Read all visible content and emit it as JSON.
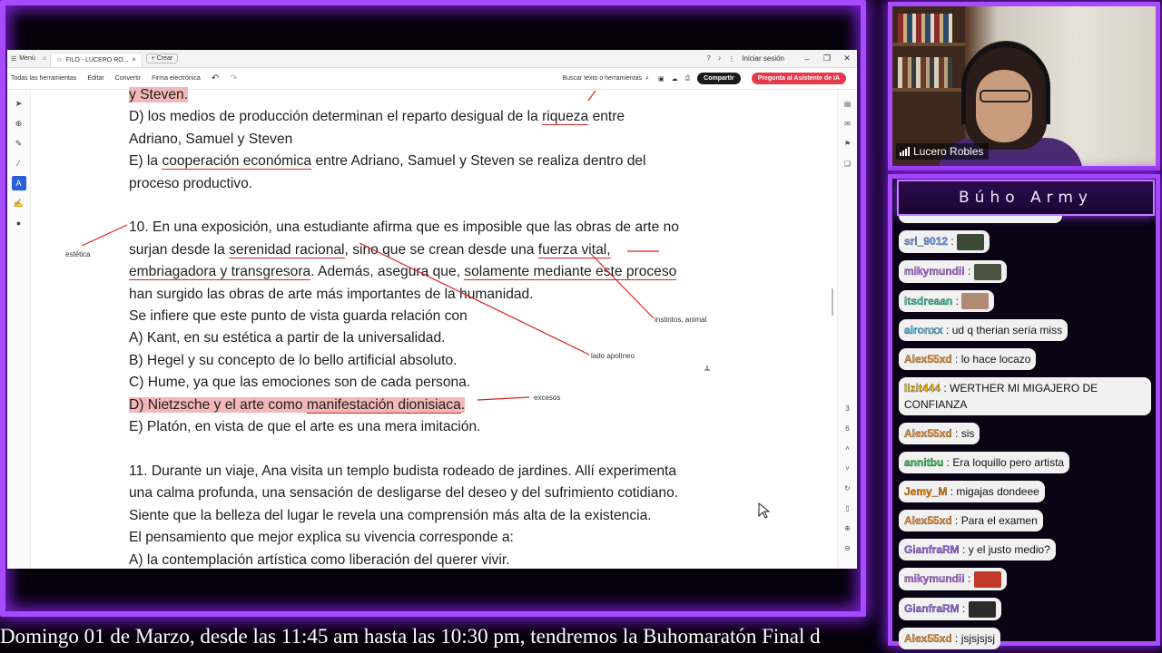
{
  "window": {
    "menu_label": "Menú",
    "tab_title": "FILO - LUCERO RO...",
    "new_tab_label": "+ Crear",
    "sign_in": "Iniciar sesión"
  },
  "toolbar": {
    "all_tools": "Todas las herramientas",
    "edit": "Editar",
    "convert": "Convertir",
    "esign": "Firma electrónica",
    "search": "Buscar texto o herramientas",
    "share": "Compartir",
    "ai_assistant": "Pregunta al Asistente de IA"
  },
  "document": {
    "line_prev": "y Steven.",
    "option_d_prev_1_pre": "D) los medios de producción determinan el reparto desigual de la ",
    "option_d_prev_1_ul": "riqueza",
    "option_d_prev_1_post": " entre",
    "option_d_prev_2": "Adriano, Samuel y Steven",
    "option_e_prev_1_pre": "E) la ",
    "option_e_prev_1_ul": "cooperación económica",
    "option_e_prev_1_post": " entre Adriano, Samuel y Steven se realiza dentro del",
    "option_e_prev_2": "proceso productivo.",
    "q10_l1": "10. En una exposición, una estudiante afirma que es imposible que las obras de arte no",
    "q10_l2_pre": "surjan desde la ",
    "q10_l2_ul1": "serenidad racional",
    "q10_l2_mid": ", sino que se crean desde una ",
    "q10_l2_ul2": "fuerza vital,",
    "q10_l3_ul1": "embriagadora y transgresora",
    "q10_l3_mid": ". Además, asegura que, ",
    "q10_l3_ul2": "solamente mediante este proceso",
    "q10_l4": "han surgido las obras de arte más importantes de la humanidad.",
    "q10_l5": "Se infiere que este punto de vista guarda relación con",
    "q10_a": "A) Kant, en su estética a partir de la universalidad.",
    "q10_b": "B) Hegel y su concepto de lo bello artificial absoluto.",
    "q10_c": "C) Hume, ya que las emociones son de cada persona.",
    "q10_d_pre": "D) Nietzsche y el arte como ",
    "q10_d_ul": "manifestación dionisiaca",
    "q10_d_post": ".",
    "q10_e": "E) Platón, en vista de que el arte es una mera imitación.",
    "q11_l1": "11. Durante un viaje, Ana visita un templo budista rodeado de jardines. Allí experimenta",
    "q11_l2": "una calma profunda, una sensación de desligarse del deseo y del sufrimiento cotidiano.",
    "q11_l3": "Siente que la belleza del lugar le revela una comprensión más alta de la existencia.",
    "q11_l4": "El pensamiento que mejor explica su vivencia corresponde a:",
    "q11_a": "A) la contemplación artística como liberación del querer vivir."
  },
  "notes": {
    "estetica": "estética",
    "instintos": "instintos, animal",
    "apolineo": "lado apolíneo",
    "excesos": "excesos"
  },
  "page_indicator": [
    "3",
    "6"
  ],
  "ticker": "Domingo 01 de Marzo, desde las 11:45 am hasta las 10:30 pm, tendremos la Buhomaratón Final d",
  "webcam": {
    "name": "Lucero Robles"
  },
  "chat": {
    "title": "Búho Army",
    "messages": [
      {
        "user": "srl_9012",
        "text": "",
        "color": "#7aa7ff",
        "emote": "#3d4a36"
      },
      {
        "user": "mikymundii",
        "text": "",
        "color": "#c56bff",
        "emote": "#4a5240"
      },
      {
        "user": "itsdreaan",
        "text": "",
        "color": "#35d6a8",
        "emote": "#b08a72"
      },
      {
        "user": "aironxx",
        "text": "ud q therian sería miss",
        "color": "#56c5f5",
        "emote": ""
      },
      {
        "user": "Alex55xd",
        "text": "lo hace locazo",
        "color": "#ff9c3a",
        "emote": ""
      },
      {
        "user": "lizit444",
        "text": "WERTHER MI MIGAJERO DE CONFIANZA",
        "color": "#ffbf00",
        "emote": ""
      },
      {
        "user": "Alex55xd",
        "text": "sis",
        "color": "#ff9c3a",
        "emote": ""
      },
      {
        "user": "annitbu",
        "text": "Era loquillo pero artista",
        "color": "#2fcf5a",
        "emote": ""
      },
      {
        "user": "Jemy_M",
        "text": "migajas dondeee",
        "color": "#ff8a00",
        "emote": ""
      },
      {
        "user": "Alex55xd",
        "text": "Para el examen",
        "color": "#ff9c3a",
        "emote": ""
      },
      {
        "user": "GianfraRM",
        "text": "y el justo medio?",
        "color": "#a66cff",
        "emote": ""
      },
      {
        "user": "mikymundii",
        "text": "",
        "color": "#c56bff",
        "emote": "#c0392b"
      },
      {
        "user": "GianfraRM",
        "text": "",
        "color": "#a66cff",
        "emote": "#2b2b2b"
      },
      {
        "user": "Alex55xd",
        "text": "jsjsjsjsj",
        "color": "#ff9c3a",
        "emote": ""
      }
    ]
  }
}
